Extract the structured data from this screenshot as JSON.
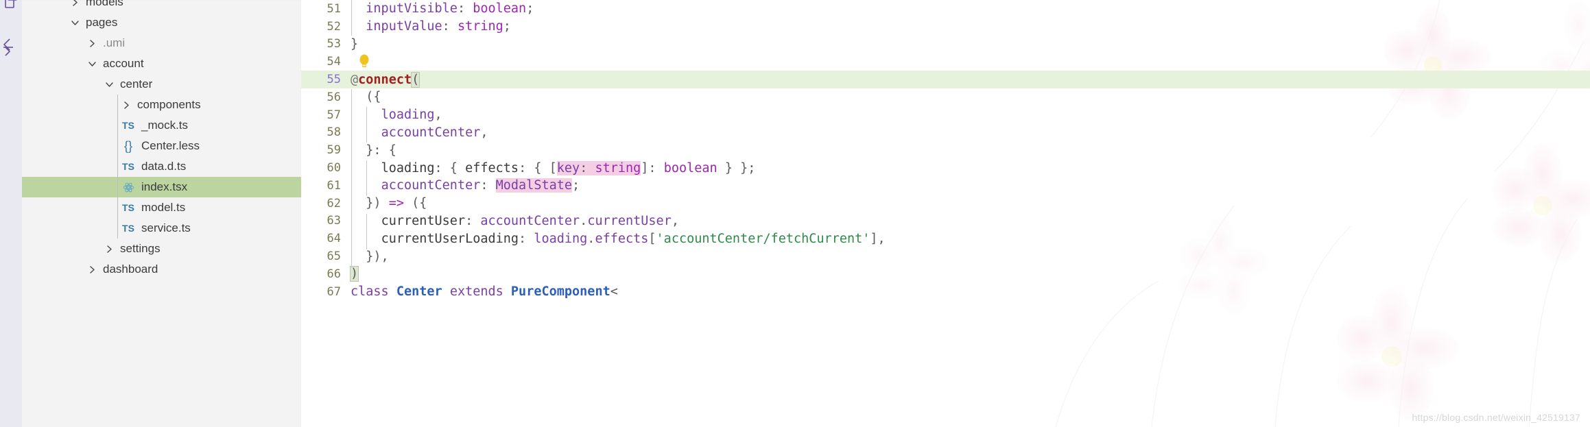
{
  "activity_bar": {
    "icons": [
      {
        "name": "explorer-icon",
        "glyph": "files"
      },
      {
        "name": "code-brackets-icon",
        "glyph": "brackets"
      }
    ]
  },
  "sidebar": {
    "tree": [
      {
        "label": "models",
        "type": "folder",
        "state": "collapsed",
        "indent": 1,
        "icon": "chevron-right-icon",
        "selected": false
      },
      {
        "label": "pages",
        "type": "folder",
        "state": "expanded",
        "indent": 1,
        "icon": "chevron-down-icon",
        "selected": false
      },
      {
        "label": ".umi",
        "type": "folder",
        "state": "collapsed",
        "indent": 2,
        "icon": "chevron-right-icon",
        "selected": false,
        "dim": true
      },
      {
        "label": "account",
        "type": "folder",
        "state": "expanded",
        "indent": 2,
        "icon": "chevron-down-icon",
        "selected": false
      },
      {
        "label": "center",
        "type": "folder",
        "state": "expanded",
        "indent": 3,
        "icon": "chevron-down-icon",
        "selected": false
      },
      {
        "label": "components",
        "type": "folder",
        "state": "collapsed",
        "indent": 4,
        "icon": "chevron-right-icon",
        "selected": false
      },
      {
        "label": "_mock.ts",
        "type": "file",
        "indent": 4,
        "icon": "ts-file-icon",
        "badge": "TS",
        "selected": false
      },
      {
        "label": "Center.less",
        "type": "file",
        "indent": 4,
        "icon": "less-file-icon",
        "badge": "{}",
        "selected": false
      },
      {
        "label": "data.d.ts",
        "type": "file",
        "indent": 4,
        "icon": "ts-file-icon",
        "badge": "TS",
        "selected": false
      },
      {
        "label": "index.tsx",
        "type": "file",
        "indent": 4,
        "icon": "react-file-icon",
        "badge": "react",
        "selected": true
      },
      {
        "label": "model.ts",
        "type": "file",
        "indent": 4,
        "icon": "ts-file-icon",
        "badge": "TS",
        "selected": false
      },
      {
        "label": "service.ts",
        "type": "file",
        "indent": 4,
        "icon": "ts-file-icon",
        "badge": "TS",
        "selected": false
      },
      {
        "label": "settings",
        "type": "folder",
        "state": "collapsed",
        "indent": 3,
        "icon": "chevron-right-icon",
        "selected": false
      },
      {
        "label": "dashboard",
        "type": "folder",
        "state": "collapsed",
        "indent": 2,
        "icon": "chevron-right-icon",
        "selected": false
      }
    ]
  },
  "editor": {
    "active_line": 55,
    "lightbulb": {
      "line": 54,
      "name": "quick-fix-lightbulb"
    },
    "lines": [
      {
        "num": "51",
        "tokens": [
          {
            "t": "  ",
            "c": "t-plain"
          },
          {
            "t": "inputVisible",
            "c": "t-ident"
          },
          {
            "t": ": ",
            "c": "t-punc"
          },
          {
            "t": "boolean",
            "c": "t-kw"
          },
          {
            "t": ";",
            "c": "t-punc"
          }
        ]
      },
      {
        "num": "52",
        "tokens": [
          {
            "t": "  ",
            "c": "t-plain"
          },
          {
            "t": "inputValue",
            "c": "t-ident"
          },
          {
            "t": ": ",
            "c": "t-punc"
          },
          {
            "t": "string",
            "c": "t-kw"
          },
          {
            "t": ";",
            "c": "t-punc"
          }
        ]
      },
      {
        "num": "53",
        "tokens": [
          {
            "t": "}",
            "c": "t-punc"
          }
        ]
      },
      {
        "num": "54",
        "tokens": [
          {
            "t": "",
            "c": "t-plain"
          }
        ]
      },
      {
        "num": "55",
        "tokens": [
          {
            "t": "@",
            "c": "t-at"
          },
          {
            "t": "connect",
            "c": "t-deco"
          },
          {
            "t": "(",
            "c": "t-punc bracket-match"
          }
        ]
      },
      {
        "num": "56",
        "tokens": [
          {
            "t": "  ({",
            "c": "t-punc"
          }
        ]
      },
      {
        "num": "57",
        "tokens": [
          {
            "t": "    ",
            "c": "t-plain"
          },
          {
            "t": "loading",
            "c": "t-ident"
          },
          {
            "t": ",",
            "c": "t-punc"
          }
        ]
      },
      {
        "num": "58",
        "tokens": [
          {
            "t": "    ",
            "c": "t-plain"
          },
          {
            "t": "accountCenter",
            "c": "t-ident"
          },
          {
            "t": ",",
            "c": "t-punc"
          }
        ]
      },
      {
        "num": "59",
        "tokens": [
          {
            "t": "  }: {",
            "c": "t-punc"
          }
        ]
      },
      {
        "num": "60",
        "tokens": [
          {
            "t": "    ",
            "c": "t-plain"
          },
          {
            "t": "loading",
            "c": "t-prop"
          },
          {
            "t": ": { ",
            "c": "t-punc"
          },
          {
            "t": "effects",
            "c": "t-prop"
          },
          {
            "t": ": { [",
            "c": "t-punc"
          },
          {
            "t": "key",
            "c": "t-ident hl-pink"
          },
          {
            "t": ": ",
            "c": "t-punc hl-pink"
          },
          {
            "t": "string",
            "c": "t-kw hl-pink"
          },
          {
            "t": "]: ",
            "c": "t-punc"
          },
          {
            "t": "boolean",
            "c": "t-kw"
          },
          {
            "t": " } };",
            "c": "t-punc"
          }
        ]
      },
      {
        "num": "61",
        "tokens": [
          {
            "t": "    ",
            "c": "t-plain"
          },
          {
            "t": "accountCenter",
            "c": "t-ident"
          },
          {
            "t": ": ",
            "c": "t-punc"
          },
          {
            "t": "ModalState",
            "c": "t-type hl-pink"
          },
          {
            "t": ";",
            "c": "t-punc"
          }
        ]
      },
      {
        "num": "62",
        "tokens": [
          {
            "t": "  }) ",
            "c": "t-punc"
          },
          {
            "t": "=>",
            "c": "t-arrow"
          },
          {
            "t": " ({",
            "c": "t-punc"
          }
        ]
      },
      {
        "num": "63",
        "tokens": [
          {
            "t": "    ",
            "c": "t-plain"
          },
          {
            "t": "currentUser",
            "c": "t-prop"
          },
          {
            "t": ": ",
            "c": "t-punc"
          },
          {
            "t": "accountCenter",
            "c": "t-ident"
          },
          {
            "t": ".",
            "c": "t-punc"
          },
          {
            "t": "currentUser",
            "c": "t-ident"
          },
          {
            "t": ",",
            "c": "t-punc"
          }
        ]
      },
      {
        "num": "64",
        "tokens": [
          {
            "t": "    ",
            "c": "t-plain"
          },
          {
            "t": "currentUserLoading",
            "c": "t-prop"
          },
          {
            "t": ": ",
            "c": "t-punc"
          },
          {
            "t": "loading",
            "c": "t-ident"
          },
          {
            "t": ".",
            "c": "t-punc"
          },
          {
            "t": "effects",
            "c": "t-ident"
          },
          {
            "t": "[",
            "c": "t-punc"
          },
          {
            "t": "'accountCenter/fetchCurrent'",
            "c": "t-str"
          },
          {
            "t": "],",
            "c": "t-punc"
          }
        ]
      },
      {
        "num": "65",
        "tokens": [
          {
            "t": "  }),",
            "c": "t-punc"
          }
        ]
      },
      {
        "num": "66",
        "tokens": [
          {
            "t": ")",
            "c": "t-punc bracket-match"
          }
        ]
      },
      {
        "num": "67",
        "tokens": [
          {
            "t": "class",
            "c": "t-classkw"
          },
          {
            "t": " ",
            "c": "t-plain"
          },
          {
            "t": "Center",
            "c": "t-classnm"
          },
          {
            "t": " ",
            "c": "t-plain"
          },
          {
            "t": "extends",
            "c": "t-classkw"
          },
          {
            "t": " ",
            "c": "t-plain"
          },
          {
            "t": "PureComponent",
            "c": "t-classnm"
          },
          {
            "t": "<",
            "c": "t-punc"
          }
        ]
      }
    ]
  },
  "watermark": {
    "text": "https://blog.csdn.net/weixin_42519137",
    "name": "csdn-watermark"
  },
  "colors": {
    "selection_green": "#bcd4a0",
    "current_line_green": "#e6f2dc",
    "token_pink_highlight": "#f4cfe4",
    "sidebar_bg": "#f3f3f3",
    "activity_bar_bg": "#e9e9f2",
    "ts_icon_blue": "#3a78a8"
  }
}
